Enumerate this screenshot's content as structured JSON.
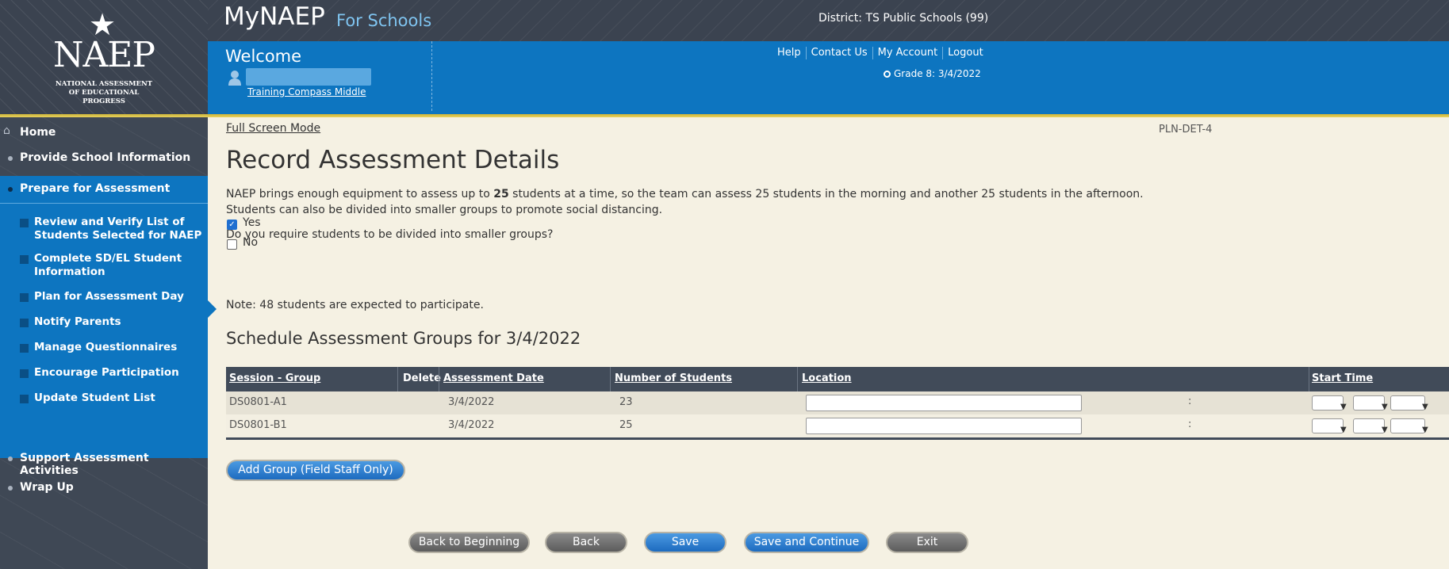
{
  "logo": {
    "wordmark": "NAEP",
    "subtitle_lines": [
      "NATIONAL ASSESSMENT",
      "OF EDUCATIONAL",
      "PROGRESS"
    ]
  },
  "header": {
    "app_title": "MyNAEP",
    "app_subtitle": "For Schools",
    "district": "District: TS Public Schools (99)"
  },
  "welcome": {
    "title": "Welcome",
    "school_link": "Training Compass Middle",
    "links": [
      "Help",
      "Contact Us",
      "My Account",
      "Logout"
    ],
    "grade": "Grade 8: 3/4/2022"
  },
  "sidebar": {
    "home": "Home",
    "provide_info": "Provide School Information",
    "prepare": "Prepare for Assessment",
    "sub_items": [
      "Review and Verify List of Students Selected for NAEP",
      "Complete SD/EL Student Information",
      "Plan for Assessment Day",
      "Notify Parents",
      "Manage Questionnaires",
      "Encourage Participation",
      "Update Student List"
    ],
    "support": "Support Assessment Activities",
    "wrap_up": "Wrap Up",
    "active_sub_item": "Plan for Assessment Day"
  },
  "main": {
    "full_screen": "Full Screen Mode",
    "page_code": "PLN-DET-4",
    "title": "Record Assessment Details",
    "intro_before": "NAEP brings enough equipment to assess up to ",
    "intro_bold": "25",
    "intro_after": " students at a time, so the team can assess 25 students in the morning and another 25 students in the afternoon.",
    "intro_line2": "Students can also be divided into smaller groups to promote social distancing.",
    "question": "Do you require students to be divided into smaller groups?",
    "yes_label": "Yes",
    "no_label": "No",
    "yes_checked": true,
    "no_checked": false,
    "note": "Note: 48 students are expected to participate.",
    "schedule_title": "Schedule Assessment Groups for 3/4/2022"
  },
  "table": {
    "headers": {
      "session": "Session - Group",
      "delete": "Delete",
      "date": "Assessment Date",
      "students": "Number of Students",
      "location": "Location",
      "start": "Start Time"
    },
    "rows": [
      {
        "session": "DS0801-A1",
        "date": "3/4/2022",
        "students": "23",
        "location": ""
      },
      {
        "session": "DS0801-B1",
        "date": "3/4/2022",
        "students": "25",
        "location": ""
      }
    ],
    "time_separator": ":"
  },
  "buttons": {
    "add_group": "Add Group (Field Staff Only)",
    "back_to_beginning": "Back to Beginning",
    "back": "Back",
    "save": "Save",
    "save_continue": "Save and Continue",
    "exit": "Exit"
  },
  "colors": {
    "brand_blue": "#0d75c0",
    "dark_bar": "#3b4350",
    "gold_rule": "#e9d25a",
    "page_bg": "#f5f1e3"
  }
}
